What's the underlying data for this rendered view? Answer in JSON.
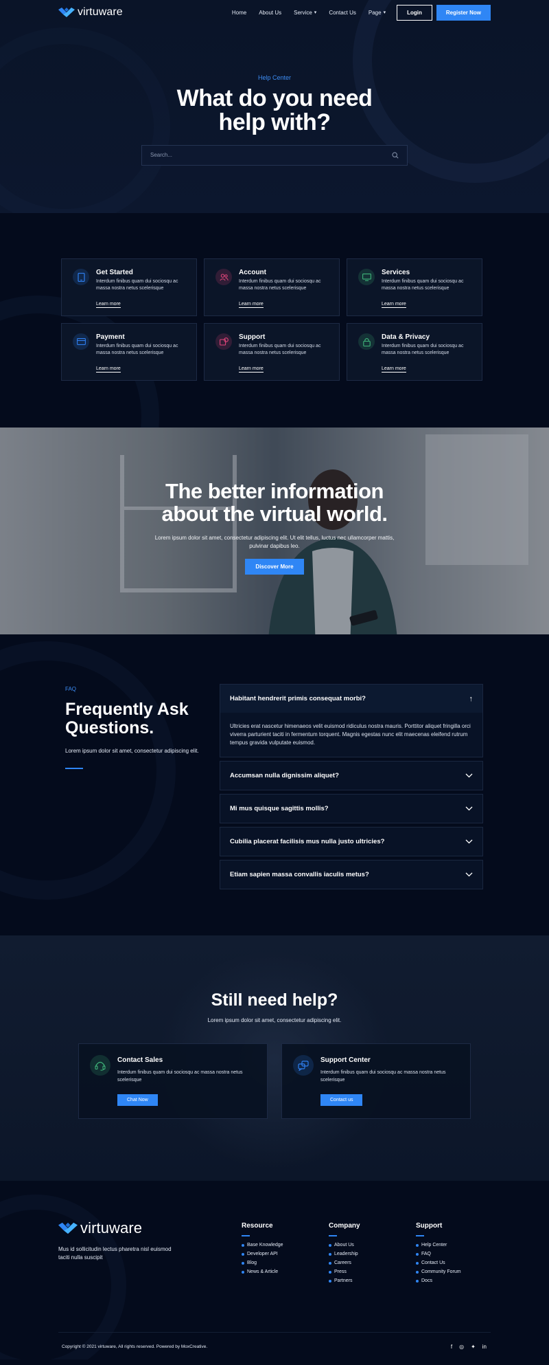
{
  "brand": {
    "name": "virtuware"
  },
  "nav": {
    "links": [
      "Home",
      "About Us",
      "Service",
      "Contact Us",
      "Page"
    ],
    "login_label": "Login",
    "register_label": "Register Now"
  },
  "hero": {
    "eyebrow": "Help Center",
    "title": "What do you need help with?",
    "search_placeholder": "Search..."
  },
  "cards": [
    {
      "title": "Get Started",
      "desc": "Interdum finibus quam dui sociosqu ac massa nostra netus scelerisque",
      "link": "Learn more",
      "icon": "tablet-icon",
      "color": "#2f7ff0"
    },
    {
      "title": "Account",
      "desc": "Interdum finibus quam dui sociosqu ac massa nostra netus scelerisque",
      "link": "Learn more",
      "icon": "users-icon",
      "color": "#e0457a"
    },
    {
      "title": "Services",
      "desc": "Interdum finibus quam dui sociosqu ac massa nostra netus scelerisque",
      "link": "Learn more",
      "icon": "monitor-icon",
      "color": "#3fb57a"
    },
    {
      "title": "Payment",
      "desc": "Interdum finibus quam dui sociosqu ac massa nostra netus scelerisque",
      "link": "Learn more",
      "icon": "credit-card-icon",
      "color": "#2f7ff0"
    },
    {
      "title": "Support",
      "desc": "Interdum finibus quam dui sociosqu ac massa nostra netus scelerisque",
      "link": "Learn more",
      "icon": "support-icon",
      "color": "#e0457a"
    },
    {
      "title": "Data & Privacy",
      "desc": "Interdum finibus quam dui sociosqu ac massa nostra netus scelerisque",
      "link": "Learn more",
      "icon": "lock-icon",
      "color": "#3fb57a"
    }
  ],
  "banner": {
    "title": "The better information about the virtual world.",
    "text": "Lorem ipsum dolor sit amet, consectetur adipiscing elit. Ut elit tellus, luctus nec ullamcorper mattis, pulvinar dapibus leo.",
    "button": "Discover More"
  },
  "faq": {
    "eyebrow": "FAQ",
    "title": "Frequently Ask Questions.",
    "subtitle": "Lorem ipsum dolor sit amet, consectetur adipiscing elit.",
    "items": [
      {
        "q": "Habitant hendrerit primis consequat morbi?",
        "a": "Ultricies erat nascetur himenaeos velit euismod ridiculus nostra mauris. Porttitor aliquet fringilla orci viverra parturient taciti in fermentum torquent. Magnis egestas nunc elit maecenas eleifend rutrum tempus gravida vulputate euismod.",
        "open": true
      },
      {
        "q": "Accumsan nulla dignissim aliquet?",
        "a": "",
        "open": false
      },
      {
        "q": "Mi mus quisque sagittis mollis?",
        "a": "",
        "open": false
      },
      {
        "q": "Cubilia placerat facilisis mus nulla justo ultricies?",
        "a": "",
        "open": false
      },
      {
        "q": "Etiam sapien massa convallis iaculis metus?",
        "a": "",
        "open": false
      }
    ]
  },
  "help": {
    "title": "Still need help?",
    "subtitle": "Lorem ipsum dolor sit amet, consectetur adipiscing elit.",
    "cards": [
      {
        "title": "Contact Sales",
        "desc": "Interdum finibus quam dui sociosqu ac massa nostra netus scelerisque",
        "button": "Chat Now",
        "icon": "headset-icon",
        "color": "#3fb57a"
      },
      {
        "title": "Support Center",
        "desc": "Interdum finibus quam dui sociosqu ac massa nostra netus scelerisque",
        "button": "Contact us",
        "icon": "chat-bubbles-icon",
        "color": "#2f7ff0"
      }
    ]
  },
  "footer": {
    "description": "Mus id sollicitudin lectus pharetra nisl euismod taciti nulla suscipit",
    "columns": [
      {
        "title": "Resource",
        "links": [
          "Base Knowledge",
          "Developer API",
          "Blog",
          "News & Article"
        ]
      },
      {
        "title": "Company",
        "links": [
          "About Us",
          "Leadership",
          "Careers",
          "Press",
          "Partners"
        ]
      },
      {
        "title": "Support",
        "links": [
          "Help Center",
          "FAQ",
          "Contact Us",
          "Community Forum",
          "Docs"
        ]
      }
    ],
    "copyright": "Copyright © 2021 virtuware, All rights reserved. Powered by MoxCreative.",
    "socials": [
      "facebook-icon",
      "instagram-icon",
      "twitter-icon",
      "linkedin-icon"
    ]
  },
  "colors": {
    "accent": "#2f86f5",
    "background": "#040b1c",
    "card": "#0b1528"
  }
}
